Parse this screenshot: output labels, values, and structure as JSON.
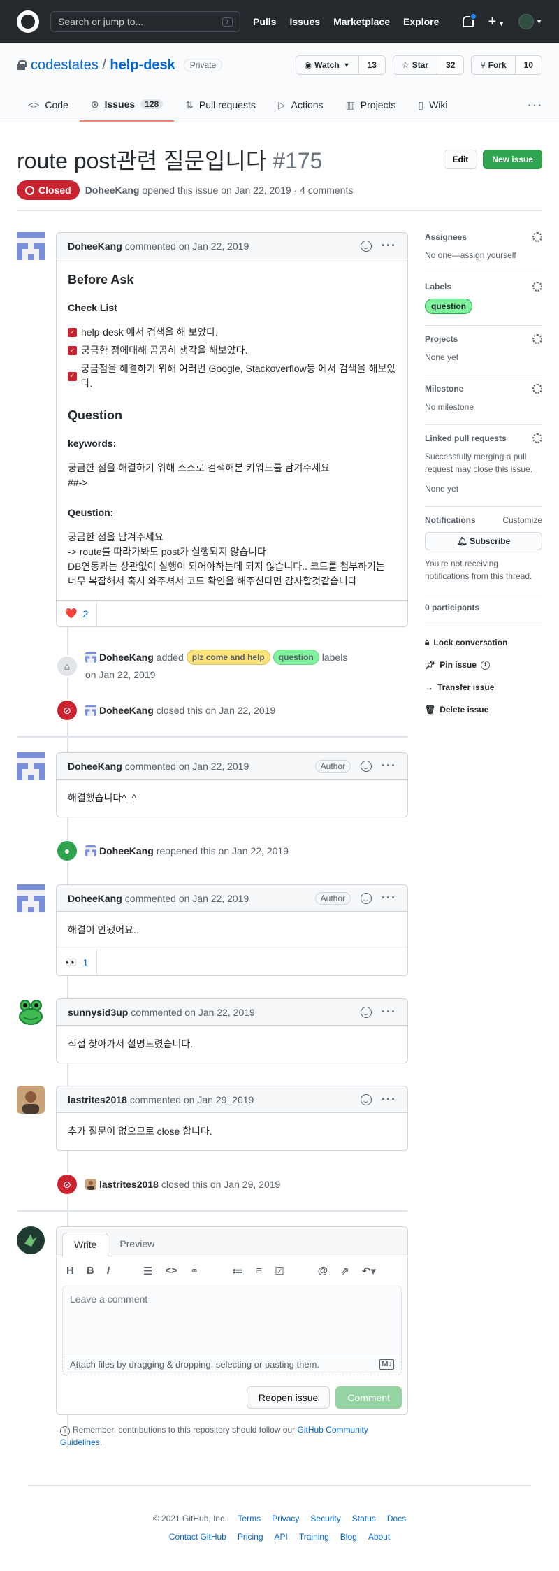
{
  "topbar": {
    "search_placeholder": "Search or jump to...",
    "slash": "/",
    "nav": [
      "Pulls",
      "Issues",
      "Marketplace",
      "Explore"
    ]
  },
  "repo": {
    "owner": "codestates",
    "sep": "/",
    "name": "help-desk",
    "visibility": "Private",
    "watch_label": "Watch",
    "watch_count": "13",
    "star_label": "Star",
    "star_count": "32",
    "fork_label": "Fork",
    "fork_count": "10"
  },
  "tabs": [
    {
      "label": "Code",
      "icon": "<>"
    },
    {
      "label": "Issues",
      "count": "128"
    },
    {
      "label": "Pull requests"
    },
    {
      "label": "Actions"
    },
    {
      "label": "Projects"
    },
    {
      "label": "Wiki"
    }
  ],
  "issue": {
    "title": "route post관련 질문입니다",
    "number": "#175",
    "status": "Closed",
    "author": "DoheeKang",
    "meta": "opened this issue on Jan 22, 2019 · 4 comments",
    "edit_label": "Edit",
    "new_label": "New issue"
  },
  "comment1": {
    "author": "DoheeKang",
    "date": "commented on Jan 22, 2019",
    "h_before": "Before Ask",
    "h_check": "Check List",
    "checks": [
      "help-desk 에서 검색을 해 보았다.",
      "궁금한 점에대해 곰곰히 생각을 해보았다.",
      "궁금점을 해결하기 위해 여러번 Google, Stackoverflow등 에서 검색을 해보았다."
    ],
    "h_question": "Question",
    "h_keywords": "keywords:",
    "kw1": "궁금한 점을 해결하기 위해 스스로 검색해본 키워드를 남겨주세요",
    "kw2": "##->",
    "h_qeustion": "Qeustion:",
    "q1": "궁금한 점을 남겨주세요",
    "q2": "-> route를 따라가봐도 post가 실행되지 않습니다",
    "q3": "DB연동과는 상관없이 실행이 되어야하는데 되지 않습니다.. 코드를 첨부하기는 너무 복잡해서 혹시 와주셔서 코드 확인을 해주신다면 감사할것같습니다",
    "reaction": "❤️",
    "reaction_count": "2"
  },
  "event_labels": {
    "author": "DoheeKang",
    "verb": "added",
    "label1": "plz come and help",
    "label2": "question",
    "tail": "labels",
    "date": "on Jan 22, 2019"
  },
  "event_closed1": {
    "author": "DoheeKang",
    "text": "closed this on Jan 22, 2019"
  },
  "comment2": {
    "author": "DoheeKang",
    "date": "commented on Jan 22, 2019",
    "badge": "Author",
    "body": "해결했습니다^_^"
  },
  "event_reopen": {
    "author": "DoheeKang",
    "text": "reopened this on Jan 22, 2019"
  },
  "comment3": {
    "author": "DoheeKang",
    "date": "commented on Jan 22, 2019",
    "badge": "Author",
    "body": "해결이 안됐어요..",
    "reaction": "👀",
    "reaction_count": "1"
  },
  "comment4": {
    "author": "sunnysid3up",
    "date": "commented on Jan 22, 2019",
    "body": "직접 찾아가서 설명드렸습니다."
  },
  "comment5": {
    "author": "lastrites2018",
    "date": "commented on Jan 29, 2019",
    "body": "추가 질문이 없으므로 close 합니다."
  },
  "event_closed2": {
    "author": "lastrites2018",
    "text": "closed this on Jan 29, 2019"
  },
  "composer": {
    "tab_write": "Write",
    "tab_preview": "Preview",
    "placeholder": "Leave a comment",
    "attach": "Attach files by dragging & dropping, selecting or pasting them.",
    "reopen": "Reopen issue",
    "comment": "Comment",
    "remember": "Remember, contributions to this repository should follow our",
    "guidelines": "GitHub Community Guidelines",
    "period": "."
  },
  "sidebar": {
    "assignees": "Assignees",
    "assignees_val": "No one—assign yourself",
    "labels": "Labels",
    "label_val": "question",
    "projects": "Projects",
    "projects_val": "None yet",
    "milestone": "Milestone",
    "milestone_val": "No milestone",
    "linked": "Linked pull requests",
    "linked_desc": "Successfully merging a pull request may close this issue.",
    "linked_val": "None yet",
    "notifications": "Notifications",
    "customize": "Customize",
    "subscribe": "Subscribe",
    "notif_desc": "You’re not receiving notifications from this thread.",
    "participants": "0 participants",
    "lock": "Lock conversation",
    "pin": "Pin issue",
    "transfer": "Transfer issue",
    "delete": "Delete issue"
  },
  "footer": {
    "copyright": "© 2021 GitHub, Inc.",
    "row1": [
      "Terms",
      "Privacy",
      "Security",
      "Status",
      "Docs"
    ],
    "row2": [
      "Contact GitHub",
      "Pricing",
      "API",
      "Training",
      "Blog",
      "About"
    ]
  },
  "colors": {
    "accent": "#0366d6",
    "closed": "#cb2431",
    "green": "#2ea44f",
    "label_help": "#fbe37a",
    "label_question": "#7ef29d"
  }
}
